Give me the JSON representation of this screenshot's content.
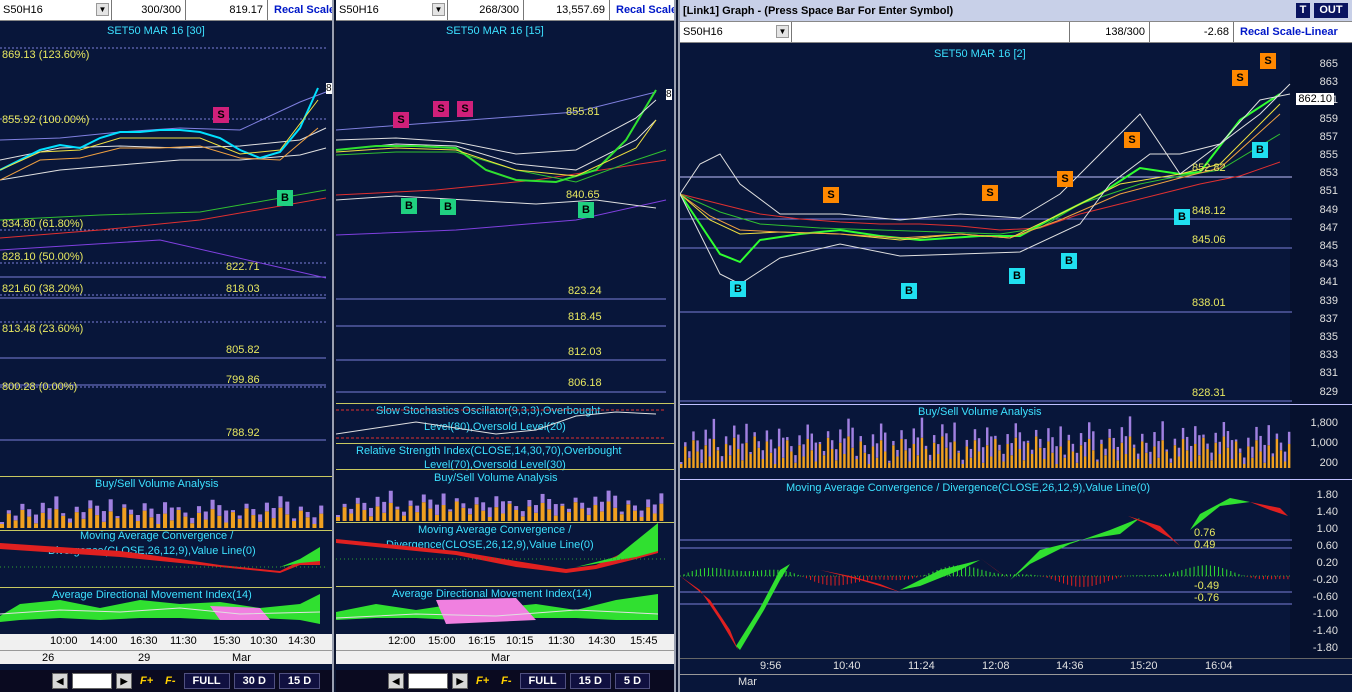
{
  "panel1": {
    "symbol": "S50H16",
    "count": "300/300",
    "value": "819.17",
    "recal": "Recal Scale",
    "chart_title": "SET50 MAR 16  [30]",
    "fib_labels": [
      "869.13 (123.60%)",
      "855.92 (100.00%)",
      "834.80 (61.80%)",
      "828.10 (50.00%)",
      "821.60 (38.20%)",
      "813.48 (23.60%)",
      "800.28 (0.00%)"
    ],
    "level_labels": [
      "822.71",
      "818.03",
      "805.82",
      "799.86",
      "788.92"
    ],
    "last_price_tag": "8",
    "vol_title": "Buy/Sell Volume Analysis",
    "macd_title_1": "Moving Average Convergence /",
    "macd_title_2": "Divergence(CLOSE,26,12,9),Value Line(0)",
    "adx_title": "Average Directional Movement Index(14)",
    "times": [
      "10:00",
      "14:00",
      "16:30",
      "11:30",
      "15:30",
      "10:30",
      "14:30"
    ],
    "dates": [
      "26",
      "29",
      "Mar"
    ],
    "buttons": [
      "FULL",
      "30 D",
      "15 D"
    ],
    "fplus": "F+",
    "fminus": "F-"
  },
  "panel2": {
    "symbol": "S50H16",
    "count": "268/300",
    "value": "13,557.69",
    "recal": "Recal Scale",
    "chart_title": "SET50 MAR 16  [15]",
    "price_labels": [
      "855.81",
      "840.65"
    ],
    "level_labels": [
      "823.24",
      "818.45",
      "812.03",
      "806.18"
    ],
    "last_price_tag": "8",
    "stoch_title_1": "Slow Stochastics Oscillator(9,3,3),Overbought",
    "stoch_title_2": "Level(80),Oversold Level(20)",
    "rsi_title_1": "Relative Strength Index(CLOSE,14,30,70),Overbought",
    "rsi_title_2": "Level(70),Oversold Level(30)",
    "vol_title": "Buy/Sell Volume Analysis",
    "macd_title_1": "Moving Average Convergence /",
    "macd_title_2": "Divergence(CLOSE,26,12,9),Value Line(0)",
    "adx_title": "Average Directional Movement Index(14)",
    "times": [
      "12:00",
      "15:00",
      "16:15",
      "10:15",
      "11:30",
      "14:30",
      "15:45"
    ],
    "dates": [
      "Mar"
    ],
    "buttons": [
      "FULL",
      "15 D",
      "5 D"
    ],
    "fplus": "F+",
    "fminus": "F-"
  },
  "panel3": {
    "window_title": "[Link1] Graph  - (Press Space Bar For Enter Symbol)",
    "btn_t": "T",
    "btn_out": "OUT",
    "symbol": "S50H16",
    "count": "138/300",
    "value": "-2.68",
    "recal": "Recal Scale-Linear",
    "chart_title": "SET50 MAR 16  [2]",
    "price_labels": [
      "852.82",
      "848.12",
      "845.06",
      "838.01",
      "828.31"
    ],
    "last_price": "862.10",
    "price_axis": [
      "865",
      "863",
      "861",
      "859",
      "857",
      "855",
      "853",
      "851",
      "849",
      "847",
      "845",
      "843",
      "841",
      "839",
      "837",
      "835",
      "833",
      "831",
      "829"
    ],
    "vol_title": "Buy/Sell Volume Analysis",
    "vol_axis": [
      "1,800",
      "1,000",
      "200"
    ],
    "macd_title": "Moving Average Convergence / Divergence(CLOSE,26,12,9),Value Line(0)",
    "macd_labels": [
      "0.76",
      "0.49",
      "-0.49",
      "-0.76"
    ],
    "macd_axis": [
      "1.80",
      "1.40",
      "1.00",
      "0.60",
      "0.20",
      "-0.20",
      "-0.60",
      "-1.00",
      "-1.40",
      "-1.80"
    ],
    "times": [
      "9:56",
      "10:40",
      "11:24",
      "12:08",
      "14:36",
      "15:20",
      "16:04"
    ],
    "dates": [
      "Mar"
    ]
  },
  "colors": {
    "bg": "#08163a",
    "cyan": "#3ce0ff",
    "yellow": "#e8e860",
    "buy_marker": "#20e0f0",
    "sell_marker": "#ff8800",
    "volume_buy": "#f0a020",
    "volume_sell": "#a080e0",
    "macd_up": "#30e030",
    "macd_down": "#e02020"
  }
}
